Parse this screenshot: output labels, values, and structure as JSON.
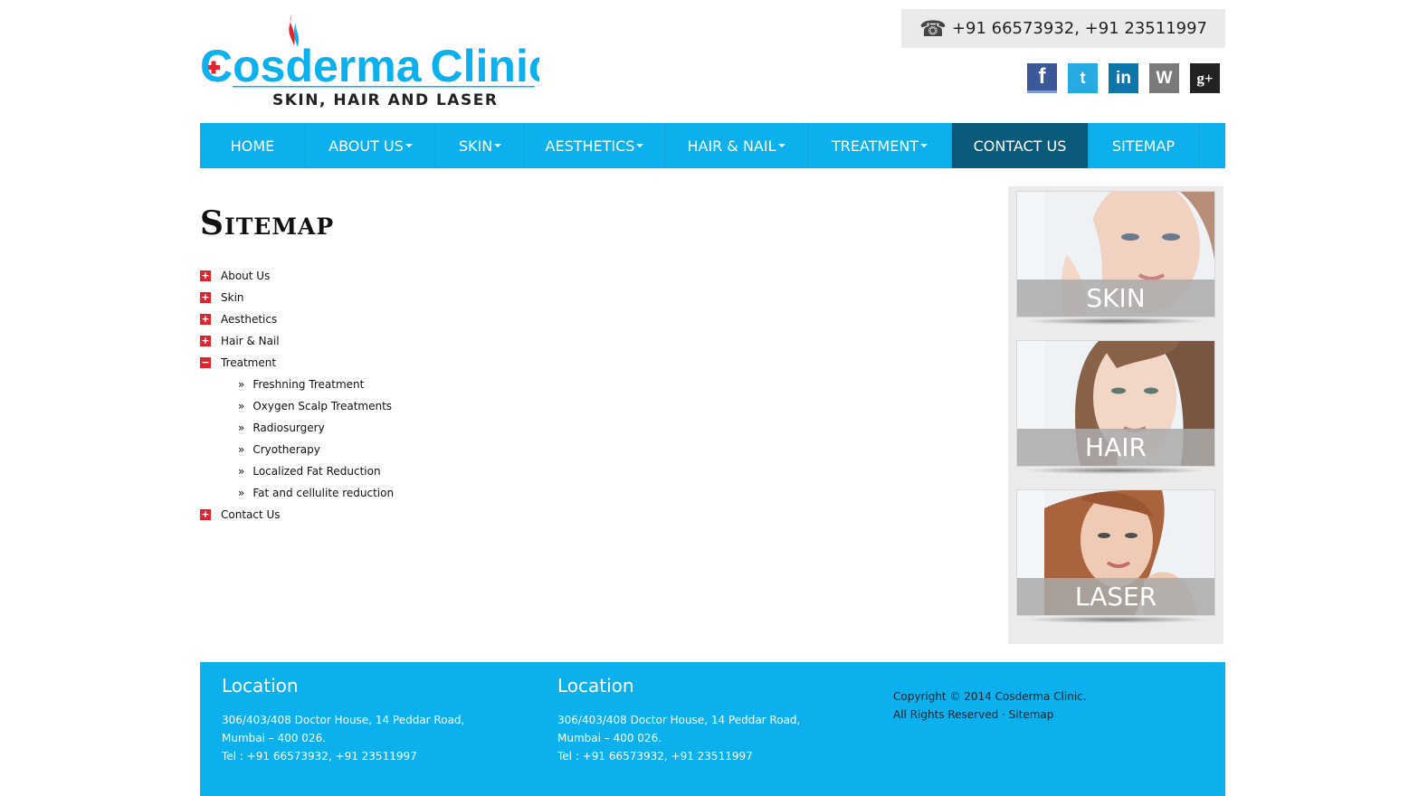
{
  "brand": {
    "name_part1": "Cosderma",
    "name_part2": "Clinic",
    "tagline": "SKIN, HAIR AND LASER",
    "color_primary": "#0cb0ec",
    "color_dark": "#0a5a7c",
    "color_accent": "#e0252f"
  },
  "header": {
    "phone_icon": "☎",
    "phone": "+91 66573932, +91 23511997",
    "social": [
      {
        "name": "facebook-icon",
        "glyph": "f"
      },
      {
        "name": "twitter-icon",
        "glyph": "t"
      },
      {
        "name": "linkedin-icon",
        "glyph": "in"
      },
      {
        "name": "wordpress-icon",
        "glyph": "W"
      },
      {
        "name": "google-plus-icon",
        "glyph": "g+"
      }
    ]
  },
  "nav": {
    "items": [
      {
        "label": "HOME",
        "dropdown": false,
        "active": false
      },
      {
        "label": "ABOUT US",
        "dropdown": true,
        "active": false
      },
      {
        "label": "SKIN",
        "dropdown": true,
        "active": false
      },
      {
        "label": "AESTHETICS",
        "dropdown": true,
        "active": false
      },
      {
        "label": "HAIR & NAIL",
        "dropdown": true,
        "active": false
      },
      {
        "label": "TREATMENT",
        "dropdown": true,
        "active": false
      },
      {
        "label": "CONTACT US",
        "dropdown": false,
        "active": true
      },
      {
        "label": "SITEMAP",
        "dropdown": false,
        "active": false
      }
    ]
  },
  "page": {
    "title": "Sitemap",
    "tree": [
      {
        "label": "About Us",
        "expanded": false
      },
      {
        "label": "Skin",
        "expanded": false
      },
      {
        "label": "Aesthetics",
        "expanded": false
      },
      {
        "label": "Hair & Nail",
        "expanded": false
      },
      {
        "label": "Treatment",
        "expanded": true,
        "children": [
          "Freshning Treatment",
          "Oxygen Scalp Treatments",
          "Radiosurgery",
          "Cryotherapy",
          "Localized Fat Reduction",
          "Fat and cellulite reduction"
        ]
      },
      {
        "label": "Contact Us",
        "expanded": false
      }
    ],
    "toggle_collapsed": "+",
    "toggle_expanded": "−",
    "child_bullet": "»"
  },
  "sidebar": {
    "cards": [
      "SKIN",
      "HAIR",
      "LASER"
    ]
  },
  "footer": {
    "col1": {
      "heading": "Location",
      "line1": "306/403/408 Doctor House, 14 Peddar Road,",
      "line2": "Mumbai – 400 026.",
      "line3": "Tel : +91 66573932, +91 23511997"
    },
    "col2": {
      "heading": "Location",
      "line1": "306/403/408 Doctor House, 14 Peddar Road,",
      "line2": "Mumbai – 400 026.",
      "line3": "Tel : +91 66573932, +91 23511997"
    },
    "copyright": "Copyright © 2014 Cosderma Clinic.",
    "rights": "All Rights Reserved ·",
    "sitemap_link": "Sitemap"
  }
}
